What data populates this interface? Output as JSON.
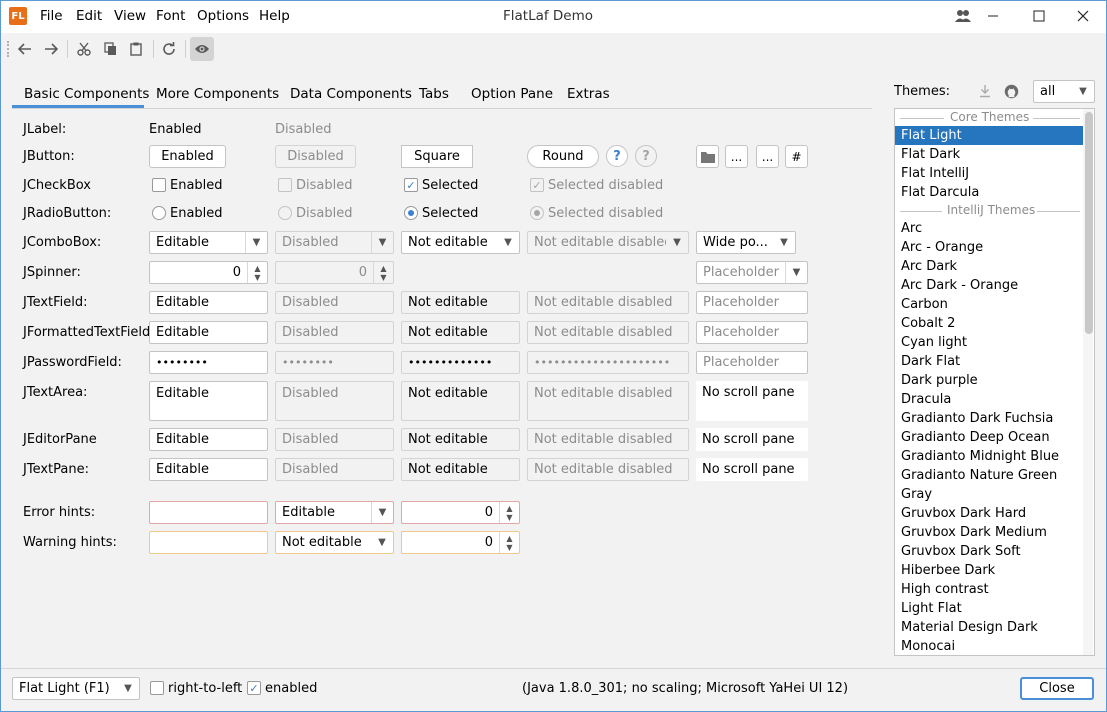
{
  "window": {
    "title": "FlatLaf Demo",
    "app_icon": "FL"
  },
  "menu": [
    "File",
    "Edit",
    "View",
    "Font",
    "Options",
    "Help"
  ],
  "tabs": [
    "Basic Components",
    "More Components",
    "Data Components",
    "Tabs",
    "Option Pane",
    "Extras"
  ],
  "labels": {
    "jlabel": "JLabel:",
    "jbutton": "JButton:",
    "jcheckbox": "JCheckBox",
    "jradio": "JRadioButton:",
    "jcombo": "JComboBox:",
    "jspinner": "JSpinner:",
    "jtextfield": "JTextField:",
    "jformatted": "JFormattedTextField:",
    "jpassword": "JPasswordField:",
    "jtextarea": "JTextArea:",
    "jeditor": "JEditorPane",
    "jtextpane": "JTextPane:",
    "error_hints": "Error hints:",
    "warning_hints": "Warning hints:"
  },
  "states": {
    "enabled": "Enabled",
    "disabled": "Disabled",
    "selected": "Selected",
    "selected_disabled": "Selected disabled",
    "editable": "Editable",
    "not_editable": "Not editable",
    "not_editable_disabled": "Not editable disabled",
    "placeholder": "Placeholder",
    "no_scroll_pane": "No scroll pane",
    "wide_popup": "Wide po...",
    "square": "Square",
    "round": "Round",
    "ellipsis": "...",
    "hash": "#",
    "spinner_value": "0",
    "password_short": "••••••••",
    "password_long": "•••••••••••••",
    "password_longest": "•••••••••••••••••••••"
  },
  "themes": {
    "label": "Themes:",
    "filter": "all",
    "core_header": "Core Themes",
    "core": [
      "Flat Light",
      "Flat Dark",
      "Flat IntelliJ",
      "Flat Darcula"
    ],
    "selected": "Flat Light",
    "intellij_header": "IntelliJ Themes",
    "intellij": [
      "Arc",
      "Arc - Orange",
      "Arc Dark",
      "Arc Dark - Orange",
      "Carbon",
      "Cobalt 2",
      "Cyan light",
      "Dark Flat",
      "Dark purple",
      "Dracula",
      "Gradianto Dark Fuchsia",
      "Gradianto Deep Ocean",
      "Gradianto Midnight Blue",
      "Gradianto Nature Green",
      "Gray",
      "Gruvbox Dark Hard",
      "Gruvbox Dark Medium",
      "Gruvbox Dark Soft",
      "Hiberbee Dark",
      "High contrast",
      "Light Flat",
      "Material Design Dark",
      "Monocai"
    ]
  },
  "bottom": {
    "theme_combo": "Flat Light (F1)",
    "rtl": "right-to-left",
    "enabled": "enabled",
    "info": "(Java 1.8.0_301; no scaling; Microsoft YaHei UI 12)",
    "close": "Close"
  },
  "colors": {
    "accent": "#2675bf",
    "error_border": "#e3a6a6",
    "warning_border": "#f0c98a",
    "window_border": "#5a9ad6"
  },
  "icons": [
    "flatlaf-logo-icon",
    "user-switch-icon",
    "minimize-icon",
    "maximize-icon",
    "close-icon",
    "back-icon",
    "forward-icon",
    "cut-icon",
    "copy-icon",
    "paste-icon",
    "refresh-icon",
    "eye-icon",
    "help-icon",
    "folder-icon",
    "download-icon",
    "github-icon",
    "chevron-down-icon",
    "spinner-arrows-icon",
    "checkmark-icon"
  ]
}
